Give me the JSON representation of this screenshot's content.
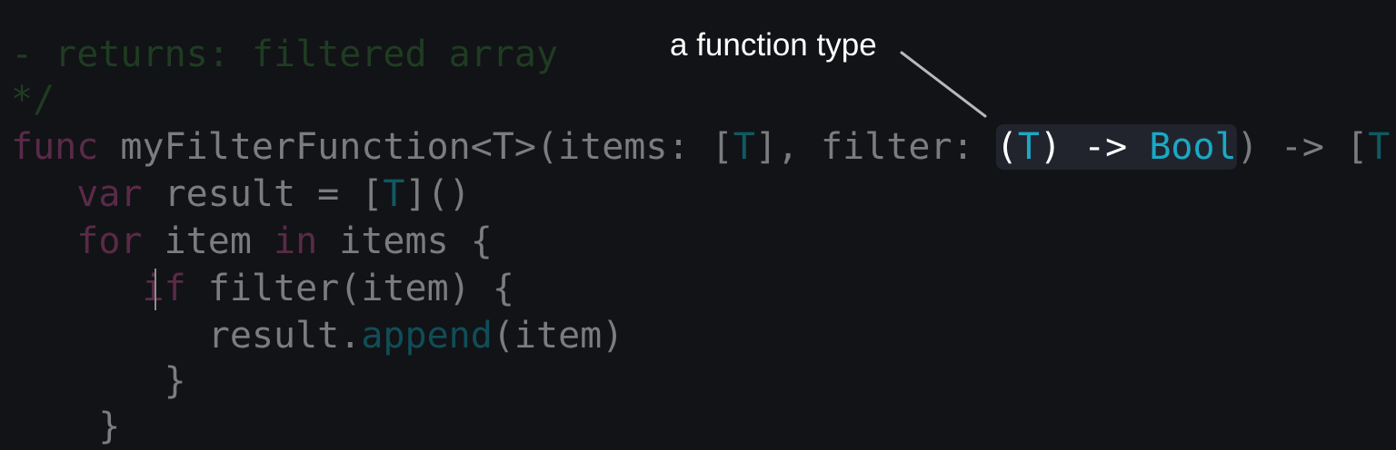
{
  "code": {
    "line1": "- returns: filtered array",
    "line2": "*/",
    "line3": {
      "kw_func": "func",
      "name": " myFilterFunction<T>(items: [",
      "t1": "T",
      "mid": "], filter: ",
      "hl_open": "(",
      "hl_t": "T",
      "hl_arrow": ") -> ",
      "hl_bool": "Bool",
      "after": ") -> [",
      "t2": "T",
      "end": "] {"
    },
    "line4": {
      "indent": "   ",
      "kw_var": "var",
      "text1": " result = [",
      "t": "T",
      "text2": "]()"
    },
    "line5": {
      "indent": "   ",
      "kw_for": "for",
      "text1": " item ",
      "kw_in": "in",
      "text2": " items {"
    },
    "line6": {
      "indent": "      ",
      "kw_if": "if",
      "text": " filter(item) {"
    },
    "line7": {
      "indent": "         ",
      "text1": "result.",
      "method": "append",
      "text2": "(item)"
    },
    "line8": {
      "indent": "      ",
      "text": " }"
    },
    "line9": {
      "indent": "   ",
      "text": " }"
    }
  },
  "annotation": {
    "label": "a function type"
  },
  "colors": {
    "background": "#121316",
    "comment": "#1f3c22",
    "keyword": "#5a2a48",
    "plain": "#7b7b80",
    "type_param": "#0e5a63",
    "highlight_type": "#1aa9c5",
    "highlight_text": "#ffffff"
  }
}
